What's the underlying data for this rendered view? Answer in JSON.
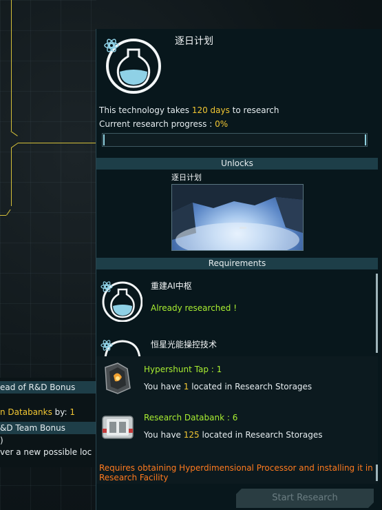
{
  "left_panel": {
    "header_bonus": "ead of R&D Bonus",
    "databanks_label": "n Databanks",
    "databanks_by": " by: ",
    "databanks_value": "1",
    "team_bonus_header": "&D Team Bonus",
    "line_paren": ")",
    "discover_text": "ver a new possible loc"
  },
  "tech": {
    "title": "逐日计划",
    "takes_prefix": "This technology takes ",
    "takes_value": "120 days",
    "takes_suffix": " to research",
    "progress_label": "Current research progress : ",
    "progress_value": "0%",
    "progress_fraction": 0
  },
  "unlocks": {
    "header": "Unlocks",
    "item_name": "逐日计划"
  },
  "requirements": {
    "header": "Requirements",
    "items": [
      {
        "name": "重建AI中枢",
        "status": "Already researched !"
      },
      {
        "name": "恒星光能操控技术"
      }
    ]
  },
  "resources": [
    {
      "name": "Hypershunt Tap : 1",
      "have_prefix": "You have ",
      "have_value": "1",
      "have_suffix": " located in Research Storages"
    },
    {
      "name": "Research Databank : 6",
      "have_prefix": "You have ",
      "have_value": "125",
      "have_suffix": " located in Research Storages"
    }
  ],
  "warning": "Requires obtaining Hyperdimensional Processor and installing it in Research Facility",
  "start_button": "Start Research",
  "icons": {
    "atom": "atom-icon",
    "flask": "flask-icon",
    "hypershunt": "hypershunt-tap-icon",
    "databank": "research-databank-icon"
  },
  "colors": {
    "highlight": "#f2c733",
    "success": "#a9ef31",
    "warning": "#ff7a1f",
    "section_header": "#1d3e48"
  }
}
